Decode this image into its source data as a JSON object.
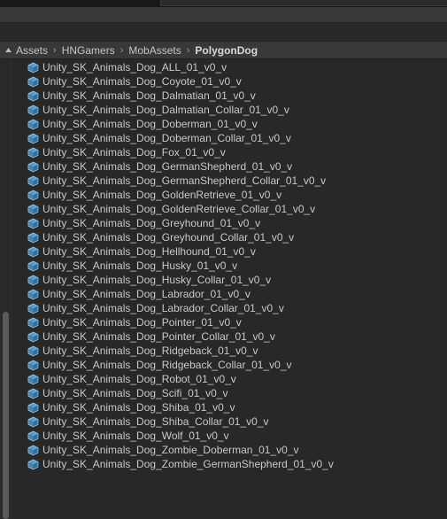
{
  "breadcrumb": {
    "items": [
      "Assets",
      "HNGamers",
      "MobAssets",
      "PolygonDog"
    ],
    "separator": "›"
  },
  "colors": {
    "prefab_icon": "#4ea6e8",
    "background": "#282828",
    "bar": "#383838",
    "text": "#c8c8c8"
  },
  "list": {
    "icon": "prefab-cube-icon",
    "items": [
      "Unity_SK_Animals_Dog_ALL_01_v0_v",
      "Unity_SK_Animals_Dog_Coyote_01_v0_v",
      "Unity_SK_Animals_Dog_Dalmatian_01_v0_v",
      "Unity_SK_Animals_Dog_Dalmatian_Collar_01_v0_v",
      "Unity_SK_Animals_Dog_Doberman_01_v0_v",
      "Unity_SK_Animals_Dog_Doberman_Collar_01_v0_v",
      "Unity_SK_Animals_Dog_Fox_01_v0_v",
      "Unity_SK_Animals_Dog_GermanShepherd_01_v0_v",
      "Unity_SK_Animals_Dog_GermanShepherd_Collar_01_v0_v",
      "Unity_SK_Animals_Dog_GoldenRetrieve_01_v0_v",
      "Unity_SK_Animals_Dog_GoldenRetrieve_Collar_01_v0_v",
      "Unity_SK_Animals_Dog_Greyhound_01_v0_v",
      "Unity_SK_Animals_Dog_Greyhound_Collar_01_v0_v",
      "Unity_SK_Animals_Dog_Hellhound_01_v0_v",
      "Unity_SK_Animals_Dog_Husky_01_v0_v",
      "Unity_SK_Animals_Dog_Husky_Collar_01_v0_v",
      "Unity_SK_Animals_Dog_Labrador_01_v0_v",
      "Unity_SK_Animals_Dog_Labrador_Collar_01_v0_v",
      "Unity_SK_Animals_Dog_Pointer_01_v0_v",
      "Unity_SK_Animals_Dog_Pointer_Collar_01_v0_v",
      "Unity_SK_Animals_Dog_Ridgeback_01_v0_v",
      "Unity_SK_Animals_Dog_Ridgeback_Collar_01_v0_v",
      "Unity_SK_Animals_Dog_Robot_01_v0_v",
      "Unity_SK_Animals_Dog_Scifi_01_v0_v",
      "Unity_SK_Animals_Dog_Shiba_01_v0_v",
      "Unity_SK_Animals_Dog_Shiba_Collar_01_v0_v",
      "Unity_SK_Animals_Dog_Wolf_01_v0_v",
      "Unity_SK_Animals_Dog_Zombie_Doberman_01_v0_v",
      "Unity_SK_Animals_Dog_Zombie_GermanShepherd_01_v0_v"
    ]
  }
}
